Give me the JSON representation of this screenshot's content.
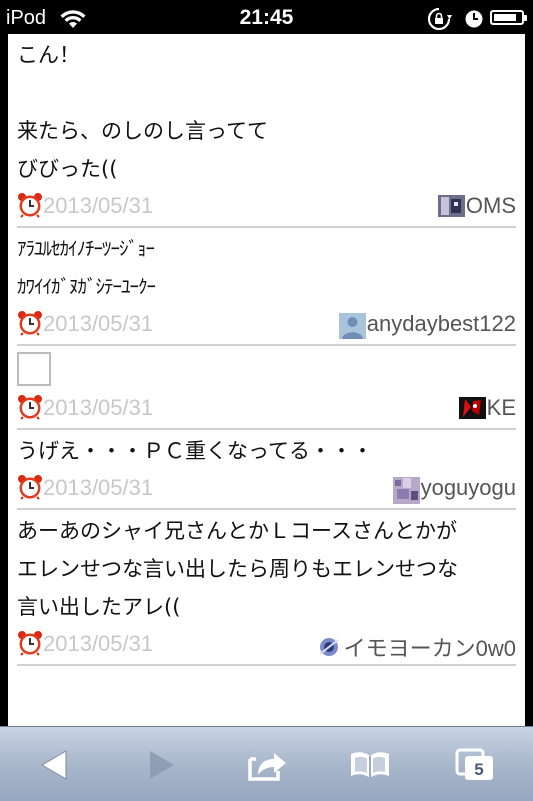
{
  "status_bar": {
    "carrier": "iPod",
    "time": "21:45",
    "battery_level": 0.85
  },
  "posts": [
    {
      "lines": [
        "こん！",
        "",
        "来たら、のしのし言ってて",
        "びびった(("
      ],
      "date": "2013/05/31",
      "user": "OMS",
      "avatar_icon": "oms-avatar-icon",
      "small": false
    },
    {
      "lines": [
        "ｱﾗﾕﾙｾｶｲﾉﾁｰﾂｰｼﾞｮｰ",
        "ｶﾜｲｲｶﾞﾇｶﾞｼﾃｰﾕｰｸｰ"
      ],
      "date": "2013/05/31",
      "user": "anydaybest122",
      "avatar_icon": "default-user-avatar-icon",
      "small": true
    },
    {
      "lines": [],
      "date": "2013/05/31",
      "user": "KE",
      "avatar_icon": "ke-avatar-icon",
      "image_placeholder": true,
      "small": false
    },
    {
      "lines": [
        "うげえ・・・ＰＣ重くなってる・・・"
      ],
      "date": "2013/05/31",
      "user": "yoguyogu",
      "avatar_icon": "yoguyogu-avatar-icon",
      "small": false
    },
    {
      "lines": [
        "あーあのシャイ兄さんとかＬコースさんとかが",
        "エレンせつな言い出したら周りもエレンせつな",
        "言い出したアレ(("
      ],
      "date": "2013/05/31",
      "user": "イモヨーカン0w0",
      "avatar_icon": "imoyokan-avatar-icon",
      "small": false
    }
  ],
  "toolbar": {
    "tabs_count": "5",
    "icons": [
      "back-arrow-icon",
      "forward-arrow-icon",
      "share-icon",
      "bookmarks-icon",
      "tabs-icon"
    ]
  },
  "colors": {
    "date_text": "#c8c8c8",
    "toolbar_top": "#c9d3e3",
    "toolbar_bottom": "#97a7bf"
  }
}
